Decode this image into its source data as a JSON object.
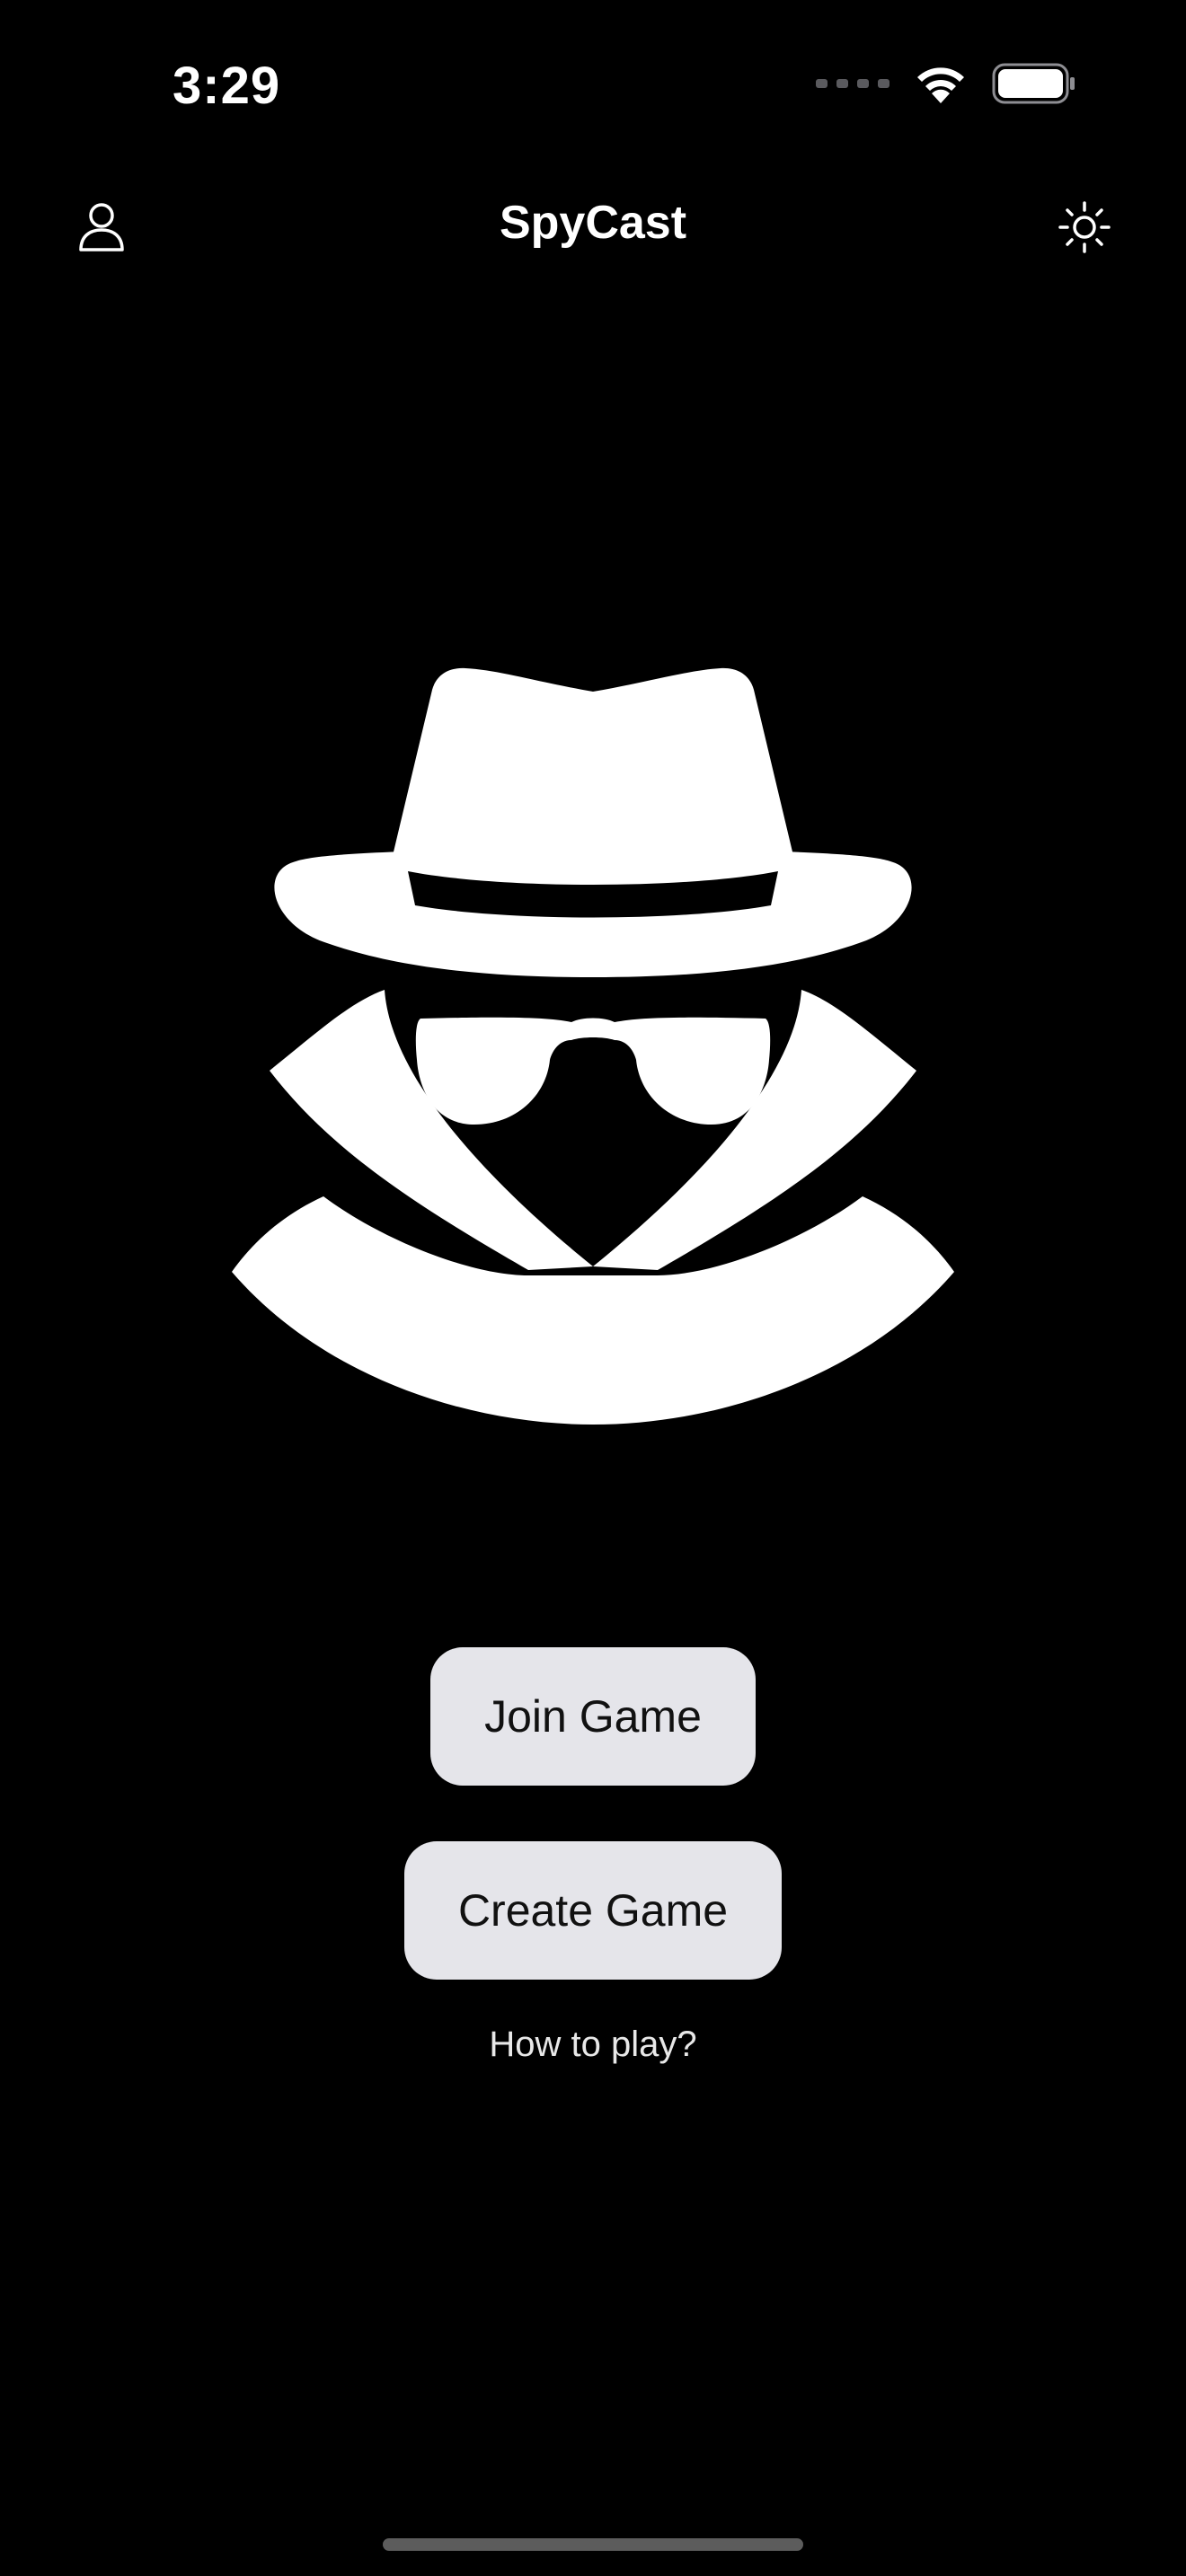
{
  "status_bar": {
    "time": "3:29",
    "icons": [
      "cellular-signal-icon",
      "wifi-icon",
      "battery-icon"
    ]
  },
  "nav": {
    "title": "SpyCast",
    "left_icon": "person-icon",
    "right_icon": "sun-icon"
  },
  "hero": {
    "icon": "spy-agent-icon"
  },
  "actions": {
    "join_label": "Join Game",
    "create_label": "Create Game",
    "how_to_play_label": "How to play?"
  },
  "colors": {
    "background": "#000000",
    "foreground": "#ffffff",
    "button_background": "#e5e5ea",
    "button_text": "#111111"
  }
}
